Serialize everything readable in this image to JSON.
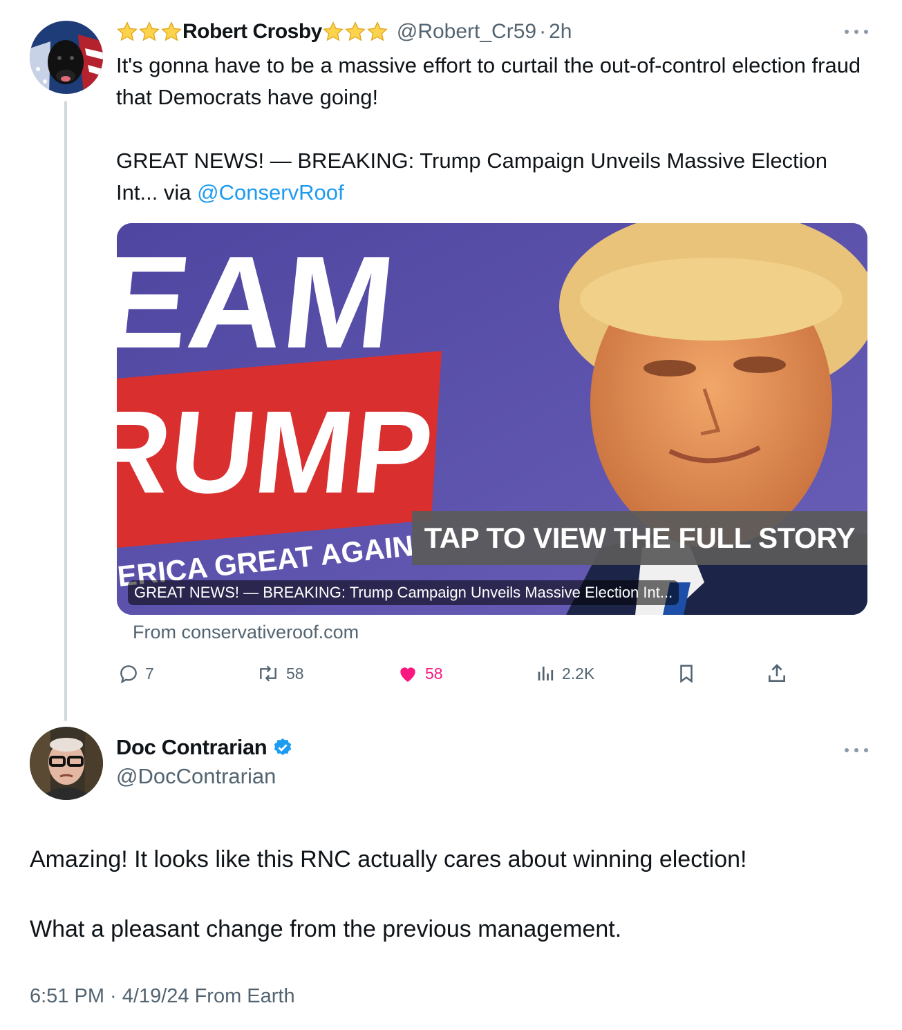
{
  "tweet": {
    "author_name": "Robert Crosby",
    "handle": "@Robert_Cr59",
    "separator": "·",
    "time": "2h",
    "text": "It's gonna have to be a massive effort to curtail the out-of-control election fraud that Democrats have going!\n\nGREAT NEWS! — BREAKING: Trump Campaign Unveils Massive Election Int... via ",
    "mention": "@ConservRoof",
    "card": {
      "image_sign_line1": "EAM",
      "image_sign_line2": "RUMP",
      "image_sign_line3": "ERICA GREAT AGAIN",
      "overlay_label": "TAP TO VIEW THE FULL STORY",
      "title": "GREAT NEWS! — BREAKING: Trump Campaign Unveils Massive Election Int...",
      "source": "From conservativeroof.com"
    },
    "actions": {
      "replies": "7",
      "reposts": "58",
      "likes": "58",
      "views": "2.2K"
    }
  },
  "reply": {
    "author_name": "Doc Contrarian",
    "handle": "@DocContrarian",
    "line1": "Amazing! It looks like this RNC actually cares about winning election!",
    "line2": "What a pleasant change from the previous management.",
    "meta": "6:51 PM · 4/19/24 From Earth"
  },
  "colors": {
    "link": "#1d9bf0",
    "like": "#f91880",
    "muted": "#536471",
    "verified": "#1d9bf0",
    "thread_line": "#cfd9de"
  },
  "icons": [
    "star-icon",
    "more-icon",
    "reply-icon",
    "repost-icon",
    "heart-icon",
    "views-icon",
    "bookmark-icon",
    "share-icon",
    "verified-badge-icon"
  ]
}
